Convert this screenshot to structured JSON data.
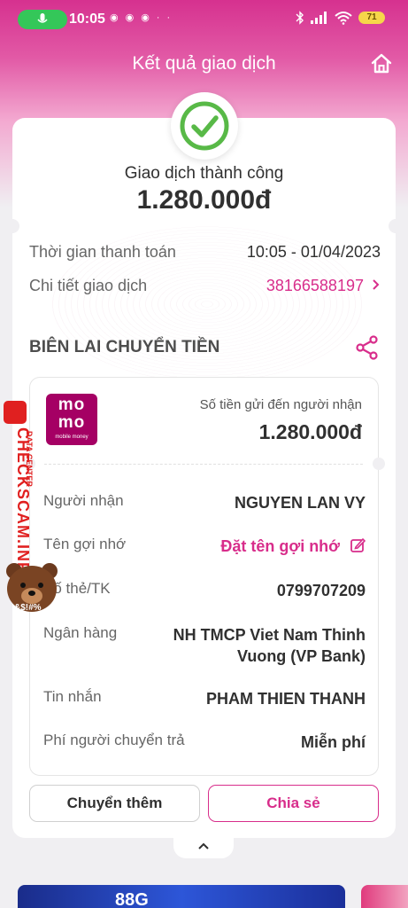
{
  "status_bar": {
    "time": "10:05",
    "battery": "71",
    "icons": [
      "mic-icon",
      "bluetooth-icon",
      "signal-icon",
      "wifi-icon",
      "battery-icon"
    ]
  },
  "header": {
    "title": "Kết quả giao dịch",
    "home_icon": "home-icon"
  },
  "result": {
    "status": "Giao dịch thành công",
    "amount": "1.280.000đ",
    "icon": "check-circle-icon",
    "accent": "#58b947"
  },
  "info": {
    "time_label": "Thời gian thanh toán",
    "time_value": "10:05 - 01/04/2023",
    "detail_label": "Chi tiết giao dịch",
    "detail_value": "38166588197"
  },
  "receipt": {
    "section_title": "BIÊN LAI CHUYỂN TIỀN",
    "logo_top": "mo",
    "logo_bottom": "mo",
    "logo_caption": "mobile money",
    "amount_label": "Số tiền gửi đến người nhận",
    "amount": "1.280.000đ",
    "rows": [
      {
        "label": "Người nhận",
        "value": "NGUYEN LAN VY"
      },
      {
        "label": "Tên gợi nhớ",
        "value": "Đặt tên gợi nhớ"
      },
      {
        "label": "Số thẻ/TK",
        "value": "0799707209"
      },
      {
        "label": "Ngân hàng",
        "value_line1": "NH TMCP Viet Nam Thinh",
        "value_line2": "Vuong (VP Bank)"
      },
      {
        "label": "Tin nhắn",
        "value": "PHAM THIEN THANH"
      },
      {
        "label": "Phí người chuyển trả",
        "value": "Miễn phí"
      }
    ]
  },
  "actions": {
    "more_label": "Chuyển thêm",
    "share_label": "Chia sẻ"
  },
  "banner": {
    "text": "88G"
  },
  "watermark": {
    "brand": "CHECKSCAM.INFO",
    "sub": "DATA CENTER",
    "bear_text": "&$!#%"
  },
  "colors": {
    "brand_pink": "#d82d8b",
    "momo_purple": "#a50064",
    "success_green": "#58b947"
  }
}
